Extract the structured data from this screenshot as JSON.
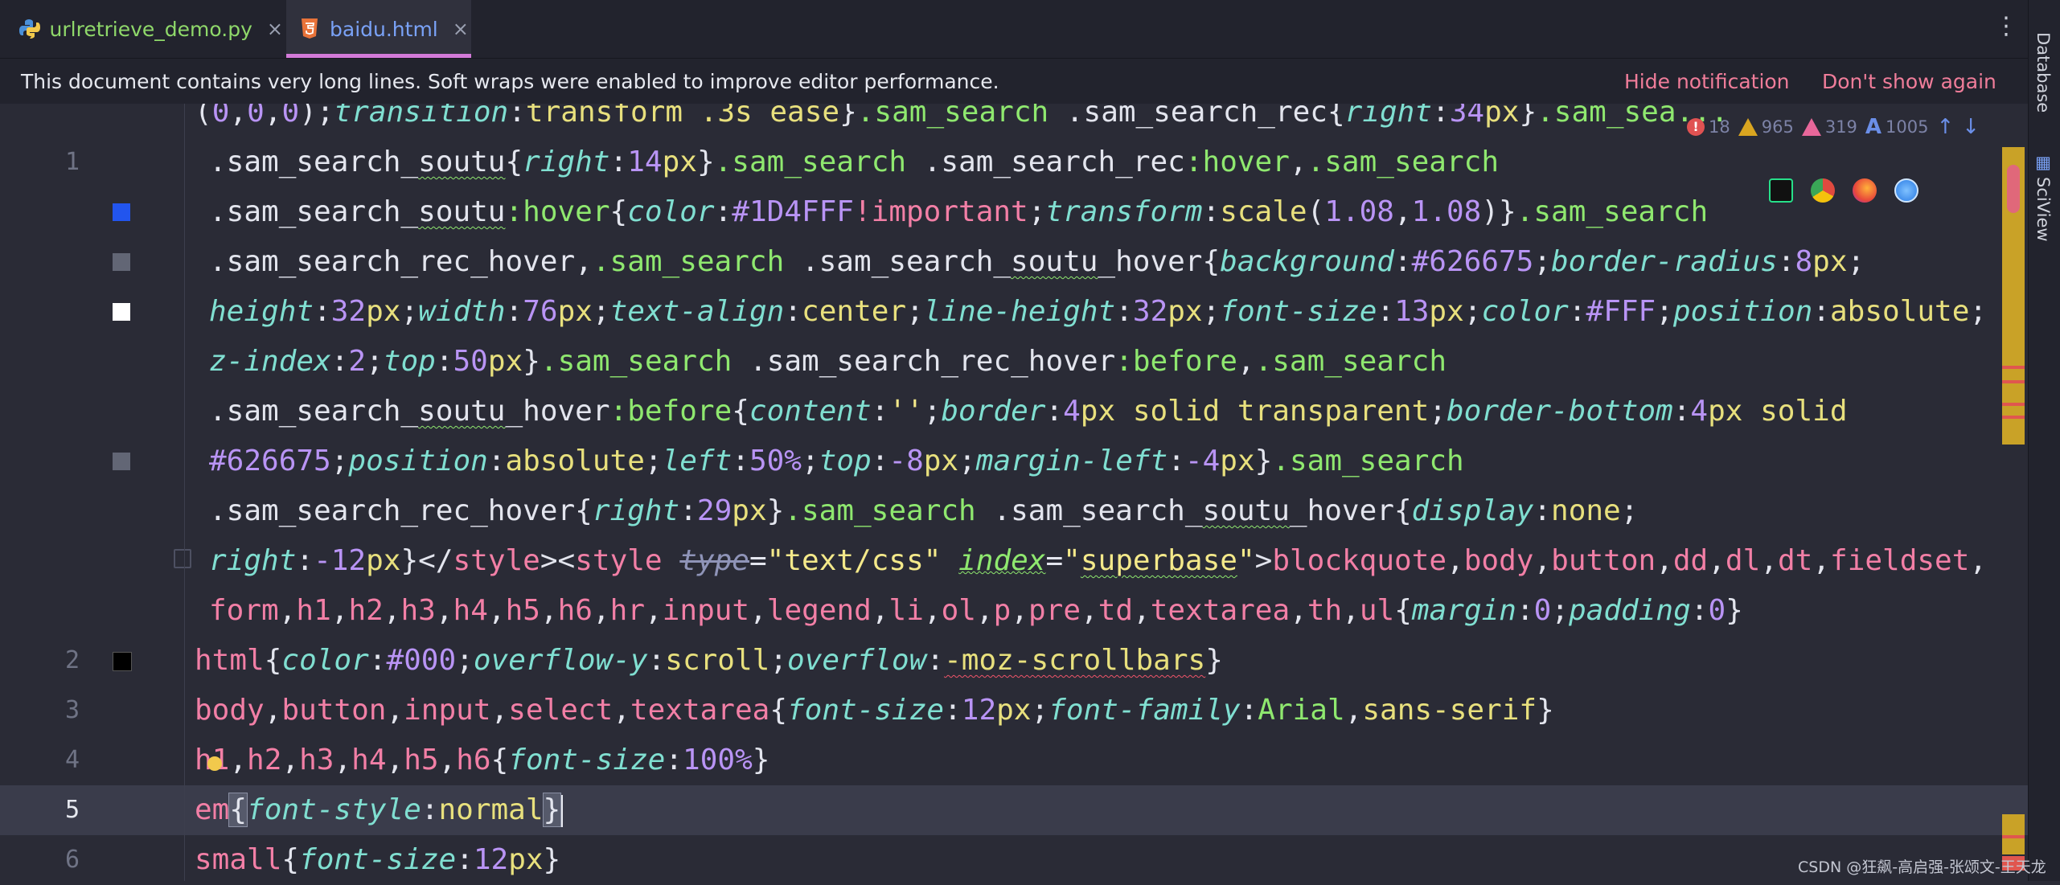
{
  "tabs": [
    {
      "label": "urlretrieve_demo.py",
      "icon": "python-icon",
      "active": false
    },
    {
      "label": "baidu.html",
      "icon": "html5-icon",
      "active": true
    }
  ],
  "tab_close_glyph": "×",
  "more_glyph": "⋮",
  "notification": {
    "message": "This document contains very long lines. Soft wraps were enabled to improve editor performance.",
    "hide": "Hide notification",
    "dont_show": "Don't show again"
  },
  "right_tools": [
    "Database",
    "SciView"
  ],
  "inspections": {
    "errors": "18",
    "warnings": "965",
    "weak_warnings": "319",
    "typos": "1005"
  },
  "line_numbers": [
    "1",
    "2",
    "3",
    "4",
    "5",
    "6"
  ],
  "watermark": "CSDN @狂飙-高启强-张颂文-王天龙",
  "colors": {
    "background": "#2a2b36",
    "tab_bar": "#22232d",
    "active_tab_underline": "#d37ad8",
    "link": "#f07d9a",
    "current_line": "#3a3c4b"
  }
}
